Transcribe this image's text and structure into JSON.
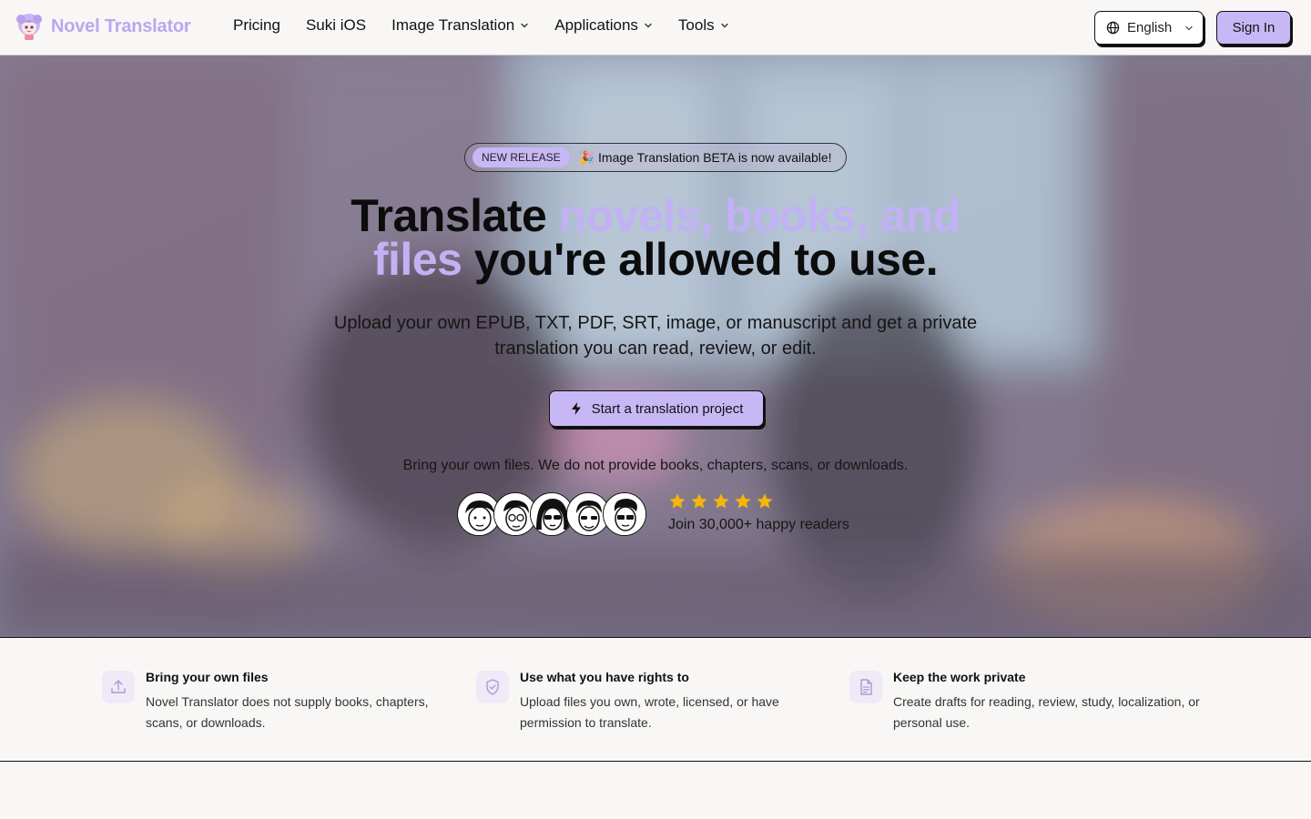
{
  "header": {
    "brand_name": "Novel Translator",
    "brand_logo_icon": "anime-girl-logo-icon",
    "nav": [
      {
        "label": "Pricing",
        "has_dropdown": false
      },
      {
        "label": "Suki iOS",
        "has_dropdown": false
      },
      {
        "label": "Image Translation",
        "has_dropdown": true
      },
      {
        "label": "Applications",
        "has_dropdown": true
      },
      {
        "label": "Tools",
        "has_dropdown": true
      }
    ],
    "language": "English",
    "signin_label": "Sign In"
  },
  "hero": {
    "release_badge": "NEW RELEASE",
    "release_text": "🎉 Image Translation BETA is now available!",
    "headline_part1": "Translate ",
    "headline_accent1": "novels, books, and",
    "headline_accent2": "files",
    "headline_part2": " you're allowed to use.",
    "subheadline": "Upload your own EPUB, TXT, PDF, SRT, image, or manuscript and get a private translation you can read, review, or edit.",
    "cta_label": "Start a translation project",
    "disclaimer": "Bring your own files. We do not provide books, chapters, scans, or downloads.",
    "rating_stars": 5,
    "readers_text": "Join 30,000+ happy readers"
  },
  "features": [
    {
      "icon": "upload-icon",
      "title": "Bring your own files",
      "desc": "Novel Translator does not supply books, chapters, scans, or downloads."
    },
    {
      "icon": "shield-check-icon",
      "title": "Use what you have rights to",
      "desc": "Upload files you own, wrote, licensed, or have permission to translate."
    },
    {
      "icon": "document-icon",
      "title": "Keep the work private",
      "desc": "Create drafts for reading, review, study, localization, or personal use."
    }
  ],
  "colors": {
    "accent": "#c7b8f5",
    "accent_text": "#c2b1f4",
    "brand_text": "#b9a8ef",
    "star": "#f5b50a",
    "background": "#f8f7f6"
  }
}
